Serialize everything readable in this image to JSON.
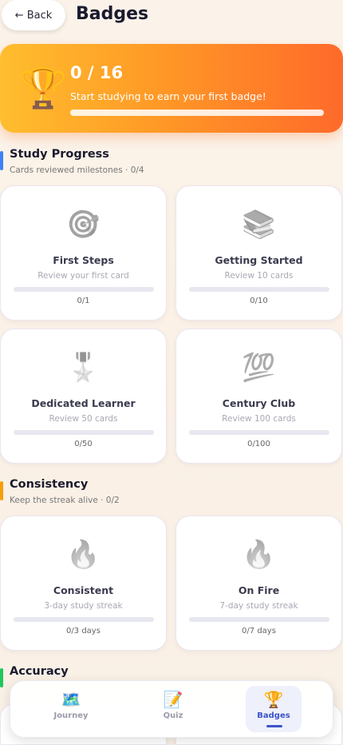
{
  "header": {
    "back_label": "← Back",
    "title": "Badges"
  },
  "hero": {
    "count": "0 / 16",
    "subtitle": "Start studying to earn your first badge!",
    "progress": 0
  },
  "sections": [
    {
      "title": "Study Progress",
      "subtitle": "Cards reviewed milestones · 0/4",
      "accent": "#3b82f6",
      "badges": [
        {
          "icon": "🎯",
          "icon_name": "target-icon",
          "name": "First Steps",
          "desc": "Review your first card",
          "progress_text": "0/1",
          "progress": 0
        },
        {
          "icon": "📚",
          "icon_name": "books-icon",
          "name": "Getting Started",
          "desc": "Review 10 cards",
          "progress_text": "0/10",
          "progress": 0
        },
        {
          "icon": "🎖️",
          "icon_name": "medal-icon",
          "name": "Dedicated Learner",
          "desc": "Review 50 cards",
          "progress_text": "0/50",
          "progress": 0
        },
        {
          "icon": "💯",
          "icon_name": "hundred-icon",
          "name": "Century Club",
          "desc": "Review 100 cards",
          "progress_text": "0/100",
          "progress": 0
        }
      ]
    },
    {
      "title": "Consistency",
      "subtitle": "Keep the streak alive · 0/2",
      "accent": "#f59e0b",
      "badges": [
        {
          "icon": "🔥",
          "icon_name": "fire-icon",
          "name": "Consistent",
          "desc": "3-day study streak",
          "progress_text": "0/3 days",
          "progress": 0
        },
        {
          "icon": "🔥",
          "icon_name": "fire-icon",
          "name": "On Fire",
          "desc": "7-day study streak",
          "progress_text": "0/7 days",
          "progress": 0
        }
      ]
    },
    {
      "title": "Accuracy",
      "accent": "#22c55e"
    }
  ],
  "nav": [
    {
      "icon": "🗺️",
      "icon_name": "map-icon",
      "label": "Journey"
    },
    {
      "icon": "📝",
      "icon_name": "memo-icon",
      "label": "Quiz"
    },
    {
      "icon": "🏆",
      "icon_name": "trophy-icon",
      "label": "Badges"
    }
  ],
  "colors": {
    "hero_gradient_start": "#ffbe2e",
    "hero_gradient_end": "#ff6a2a",
    "nav_active": "#3b54c9"
  }
}
